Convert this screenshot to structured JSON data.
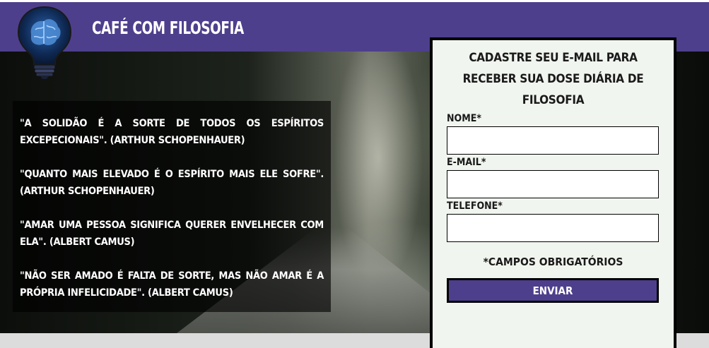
{
  "header": {
    "title": "Café com Filosofia"
  },
  "quotes": [
    "\"A solidão é a sorte de todos os espíritos excepecionais\". (Arthur Schopenhauer)",
    "\"Quanto mais elevado é o espírito mais ele sofre\". (Arthur Schopenhauer)",
    "\"Amar uma pessoa significa querer envelhecer com ela\". (Albert Camus)",
    "\"Não ser amado é falta de sorte, mas não amar é a própria infelicidade\". (Albert Camus)"
  ],
  "form": {
    "title": "Cadastre seu e-mail para receber sua dose diária de filosofia",
    "name_label": "Nome*",
    "email_label": "E-mail*",
    "phone_label": "Telefone*",
    "required_note": "*Campos obrigatórios",
    "submit_label": "Enviar"
  },
  "colors": {
    "brand_purple": "#4e3f8c",
    "panel_bg": "#f1f5ef"
  },
  "icons": {
    "logo": "lightbulb-brain-icon"
  }
}
